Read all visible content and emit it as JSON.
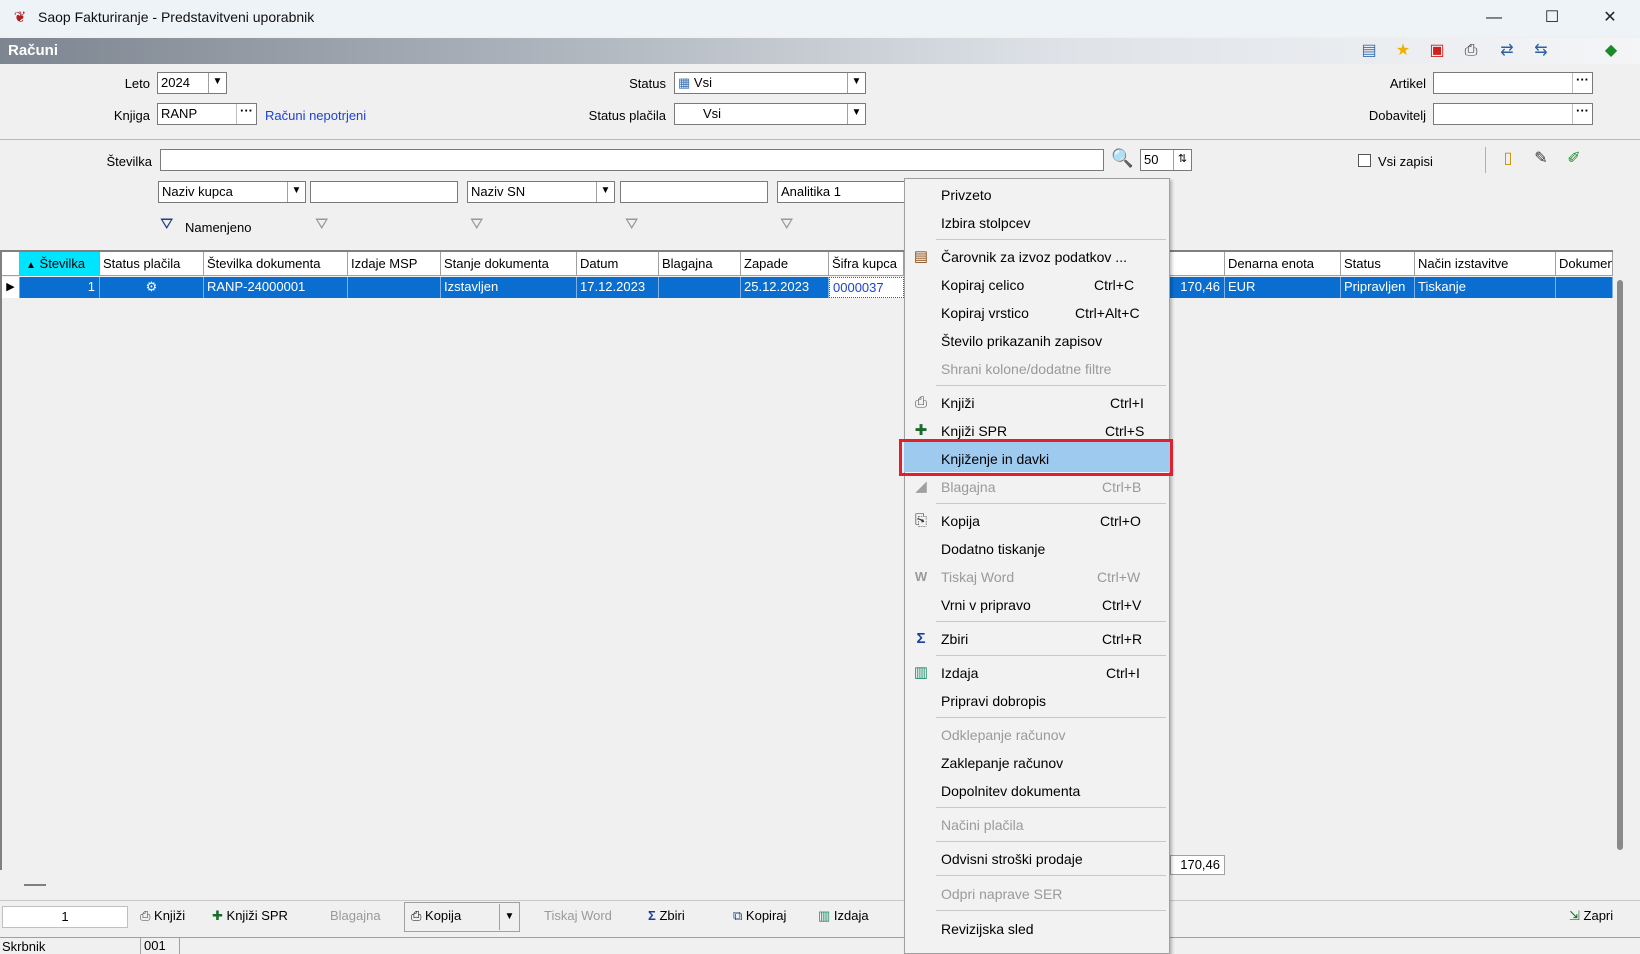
{
  "window": {
    "title": "Saop Fakturiranje - Predstavitveni uporabnik",
    "minimize_glyph": "—",
    "maximize_glyph": "☐",
    "close_glyph": "✕",
    "app_icon": "saop-app-icon"
  },
  "header": {
    "title": "Računi"
  },
  "filters": {
    "leto_label": "Leto",
    "leto_value": "2024",
    "knjiga_label": "Knjiga",
    "knjiga_value": "RANP",
    "knjiga_link": "Računi nepotrjeni",
    "status_label": "Status",
    "status_value": "Vsi",
    "status_placila_label": "Status plačila",
    "status_placila_value": "Vsi",
    "artikel_label": "Artikel",
    "artikel_value": "",
    "dobavitelj_label": "Dobavitelj",
    "dobavitelj_value": "",
    "stevilka_label": "Številka",
    "stevilka_value": "",
    "page_size": "50",
    "vsi_zapisi_label": "Vsi zapisi",
    "combo1": "Naziv kupca",
    "combo2": "Naziv SN",
    "combo3": "Analitika 1",
    "namenjeno_label": "Namenjeno"
  },
  "table": {
    "headers": [
      "Številka",
      "Status plačila",
      "Številka dokumenta",
      "Izdaje MSP",
      "Stanje dokumenta",
      "Datum",
      "Blagajna",
      "Zapade",
      "Šifra kupca",
      "Denarna enota",
      "Status",
      "Način izstavitve",
      "Dokument"
    ],
    "row": {
      "stevilka": "1",
      "status_placila": "⚙",
      "stevilka_dokumenta": "RANP-24000001",
      "izdaje_msp": "",
      "stanje": "Izstavljen",
      "datum": "17.12.2023",
      "blagajna": "",
      "zapade": "25.12.2023",
      "sifra_kupca": "0000037",
      "znesek": "170,46",
      "denarna_enota": "EUR",
      "status": "Pripravljen",
      "nacin": "Tiskanje",
      "dokument": ""
    },
    "total": "170,46"
  },
  "bottom": {
    "count": "1",
    "knjizi": "Knjiži",
    "knjizi_spr": "Knjiži SPR",
    "blagajna": "Blagajna",
    "kopija": "Kopija",
    "tiskaj_word": "Tiskaj Word",
    "zbiri": "Zbiri",
    "kopiraj": "Kopiraj",
    "izdaja": "Izdaja",
    "zapri": "Zapri"
  },
  "statusbar": {
    "user": "Skrbnik",
    "code": "001"
  },
  "context_menu": {
    "items": [
      {
        "label": "Privzeto",
        "shortcut": ""
      },
      {
        "label": "Izbira stolpcev",
        "shortcut": ""
      },
      {
        "label": "Čarovnik za izvoz podatkov ...",
        "shortcut": ""
      },
      {
        "label": "Kopiraj celico",
        "shortcut": "Ctrl+C"
      },
      {
        "label": "Kopiraj vrstico",
        "shortcut": "Ctrl+Alt+C"
      },
      {
        "label": "Število prikazanih zapisov",
        "shortcut": ""
      },
      {
        "label": "Shrani kolone/dodatne filtre",
        "shortcut": ""
      },
      {
        "label": "Knjiži",
        "shortcut": "Ctrl+I"
      },
      {
        "label": "Knjiži SPR",
        "shortcut": "Ctrl+S"
      },
      {
        "label": "Knjiženje in davki",
        "shortcut": ""
      },
      {
        "label": "Blagajna",
        "shortcut": "Ctrl+B"
      },
      {
        "label": "Kopija",
        "shortcut": "Ctrl+O"
      },
      {
        "label": "Dodatno tiskanje",
        "shortcut": ""
      },
      {
        "label": "Tiskaj Word",
        "shortcut": "Ctrl+W"
      },
      {
        "label": "Vrni v pripravo",
        "shortcut": "Ctrl+V"
      },
      {
        "label": "Zbiri",
        "shortcut": "Ctrl+R"
      },
      {
        "label": "Izdaja",
        "shortcut": "Ctrl+I"
      },
      {
        "label": "Pripravi dobropis",
        "shortcut": ""
      },
      {
        "label": "Odklepanje računov",
        "shortcut": ""
      },
      {
        "label": "Zaklepanje računov",
        "shortcut": ""
      },
      {
        "label": "Dopolnitev dokumenta",
        "shortcut": ""
      },
      {
        "label": "Načini plačila",
        "shortcut": ""
      },
      {
        "label": "Odvisni stroški prodaje",
        "shortcut": ""
      },
      {
        "label": "Odpri naprave SER",
        "shortcut": ""
      },
      {
        "label": "Revizijska sled",
        "shortcut": ""
      }
    ],
    "highlight_color": "#9fcaf0",
    "callout_color": "#e0202a"
  },
  "colors": {
    "selection": "#0a6ed1",
    "header_accent": "#00e5ff",
    "link": "#1a44d6"
  }
}
